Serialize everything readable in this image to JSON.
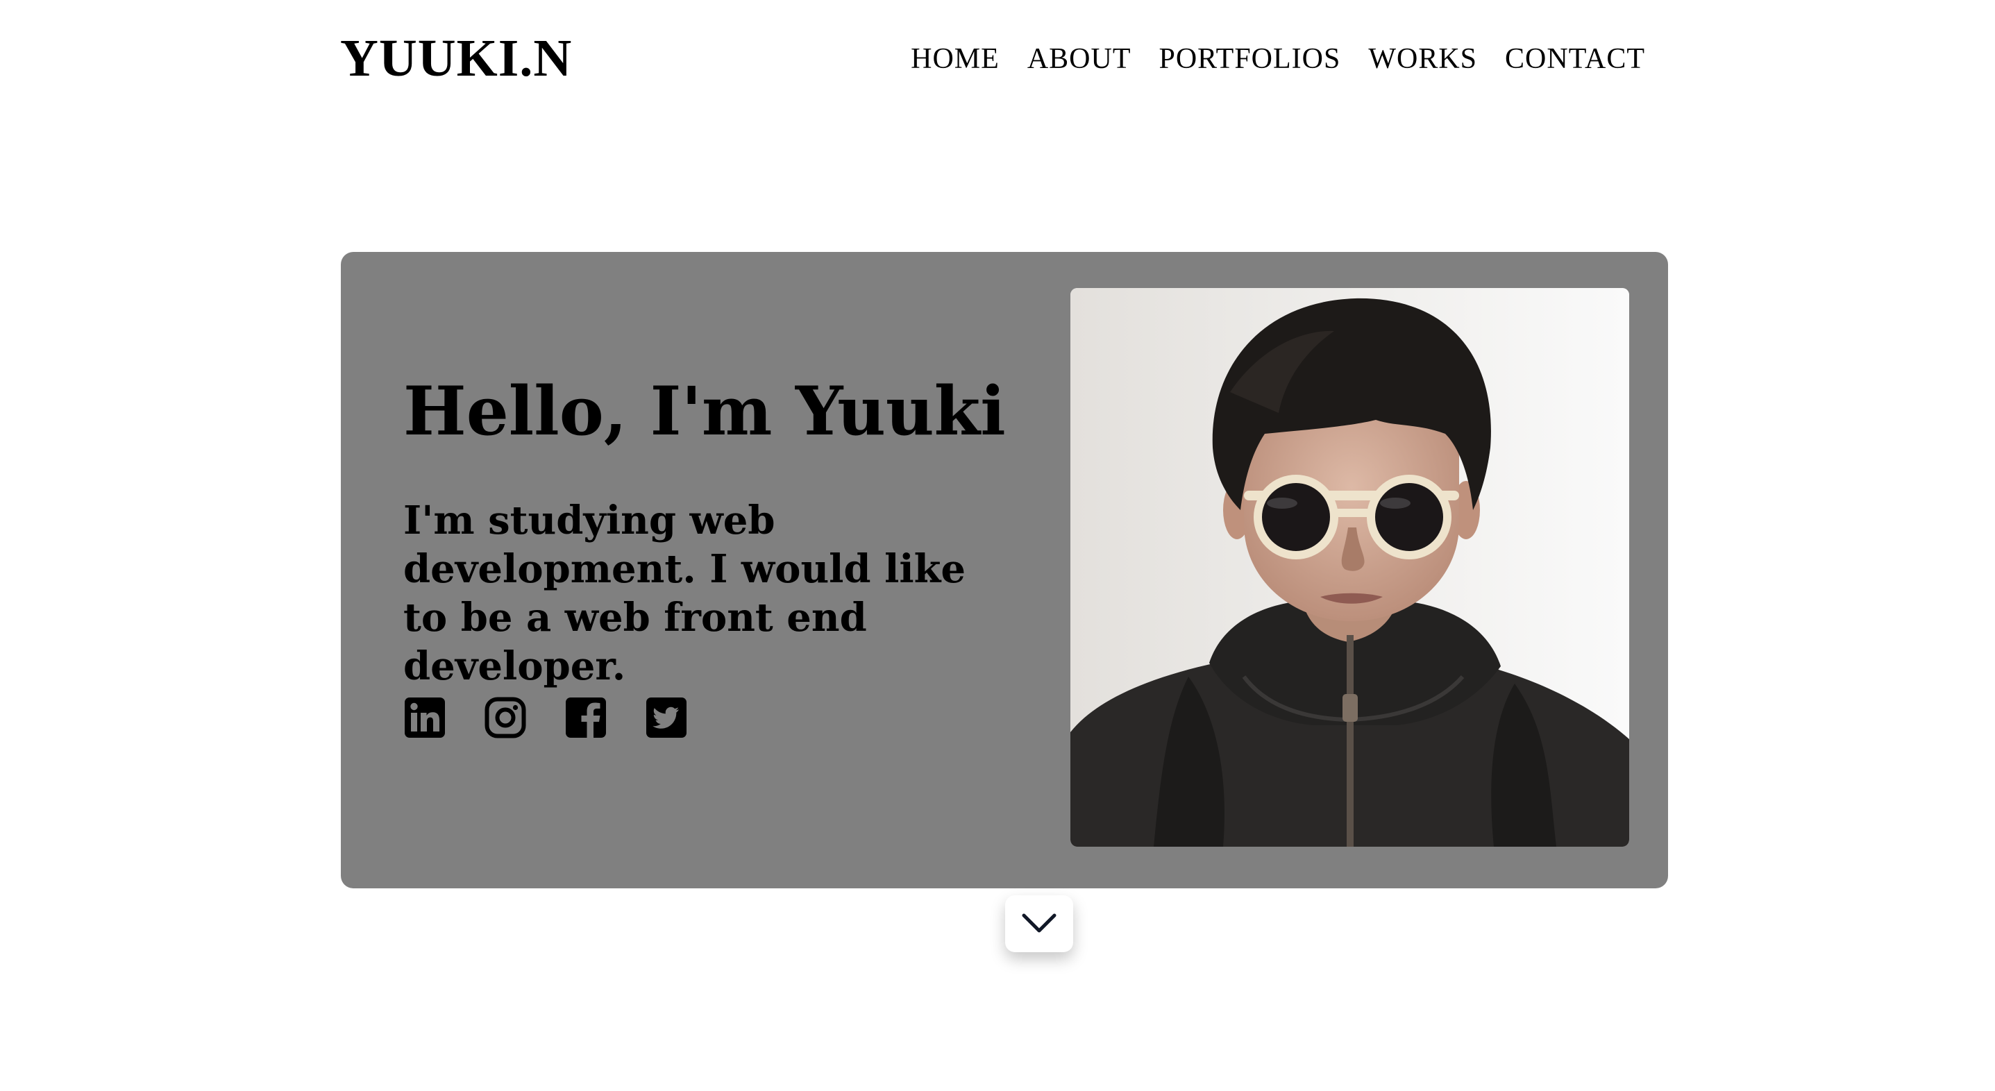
{
  "header": {
    "logo": "YUUKI.N",
    "nav": [
      "HOME",
      "ABOUT",
      "PORTFOLIOS",
      "WORKS",
      "CONTACT"
    ]
  },
  "hero": {
    "title": "Hello, I'm Yuuki",
    "description": "I'm studying web development. I would like to be a web front end developer.",
    "social_icons": [
      "linkedin-icon",
      "instagram-icon",
      "facebook-icon",
      "twitter-icon"
    ],
    "photo": "portrait-photo",
    "background_color": "#808080"
  },
  "scroll_button": {
    "icon": "chevron-down-icon"
  }
}
